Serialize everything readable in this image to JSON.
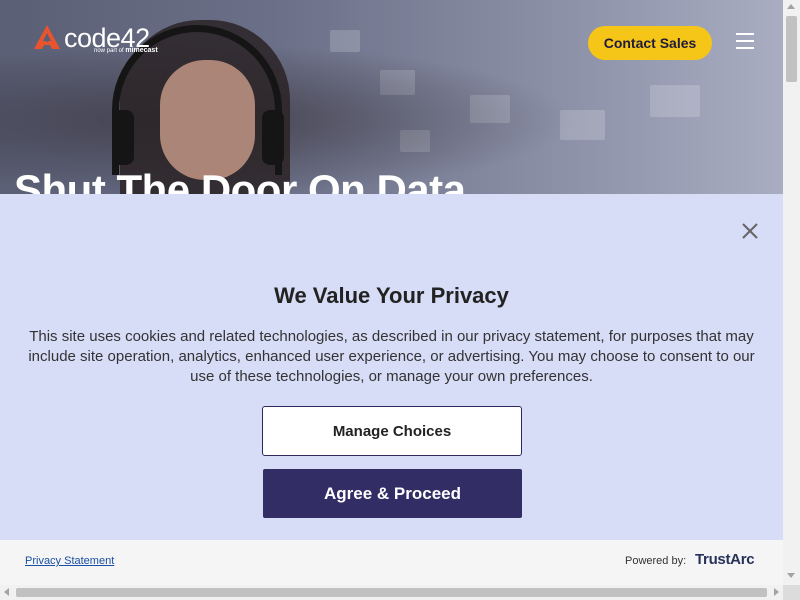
{
  "header": {
    "logo_text": "code42",
    "logo_sub_prefix": "now part of",
    "logo_sub_brand": "mimecast",
    "contact_label": "Contact Sales",
    "menu_icon": "hamburger-menu-icon"
  },
  "hero": {
    "title": "Shut The Door On Data"
  },
  "privacy_banner": {
    "title": "We Value Your Privacy",
    "body": "This site uses cookies and related technologies, as described in our privacy statement, for purposes that may include site operation, analytics, enhanced user experience, or advertising. You may choose to consent to our use of these technologies, or manage your own preferences.",
    "manage_label": "Manage Choices",
    "agree_label": "Agree & Proceed",
    "close_icon": "close-icon"
  },
  "footer": {
    "privacy_link": "Privacy Statement",
    "powered_by": "Powered by:",
    "brand_main": "TrustArc"
  },
  "colors": {
    "banner_bg": "#d7dcf7",
    "agree_bg": "#332d66",
    "contact_bg": "#f5c518",
    "logo_accent": "#e8542d"
  }
}
